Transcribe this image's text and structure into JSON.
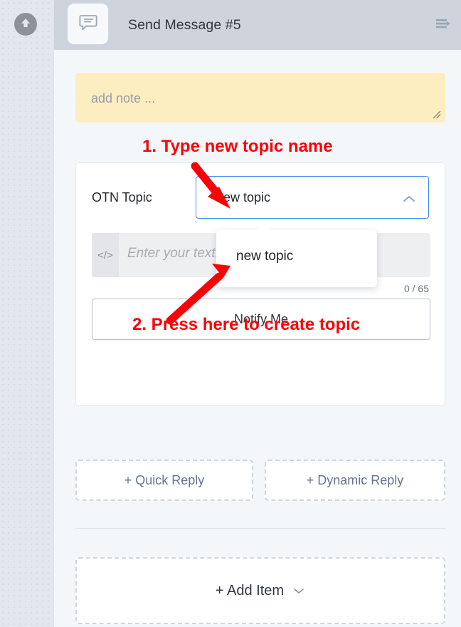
{
  "rail": {
    "up_icon": "arrow-up-circle-icon"
  },
  "topbar": {
    "title": "Send Message #5",
    "app_icon": "message-bubble-icon",
    "menu_icon": "list-arrow-icon"
  },
  "note": {
    "placeholder": "add note ...",
    "value": "",
    "resize_icon": "resize-handle-icon",
    "background": "#fdeec2"
  },
  "annotations": [
    {
      "id": "step1",
      "text": "1. Type new topic name",
      "color": "#fb0007"
    },
    {
      "id": "step2",
      "text": "2. Press here to create topic",
      "color": "#fb0007"
    }
  ],
  "card": {
    "topic": {
      "label": "OTN Topic",
      "value": "new topic",
      "placeholder": "",
      "chevron_icon": "chevron-up-icon",
      "focus_color": "#3d8ef0"
    },
    "dropdown": {
      "options": [
        "new topic"
      ],
      "selected": "new topic"
    },
    "editor": {
      "placeholder": "Enter your text...",
      "value": "",
      "tool_icon": "code-icon",
      "tool_label": "</>"
    },
    "counter": "0 / 65",
    "notify_button": "Notify Me"
  },
  "replies": [
    {
      "label": "+ Quick Reply"
    },
    {
      "label": "+ Dynamic Reply"
    }
  ],
  "add_item": {
    "label": "+ Add Item",
    "chevron_icon": "chevron-down-icon"
  }
}
